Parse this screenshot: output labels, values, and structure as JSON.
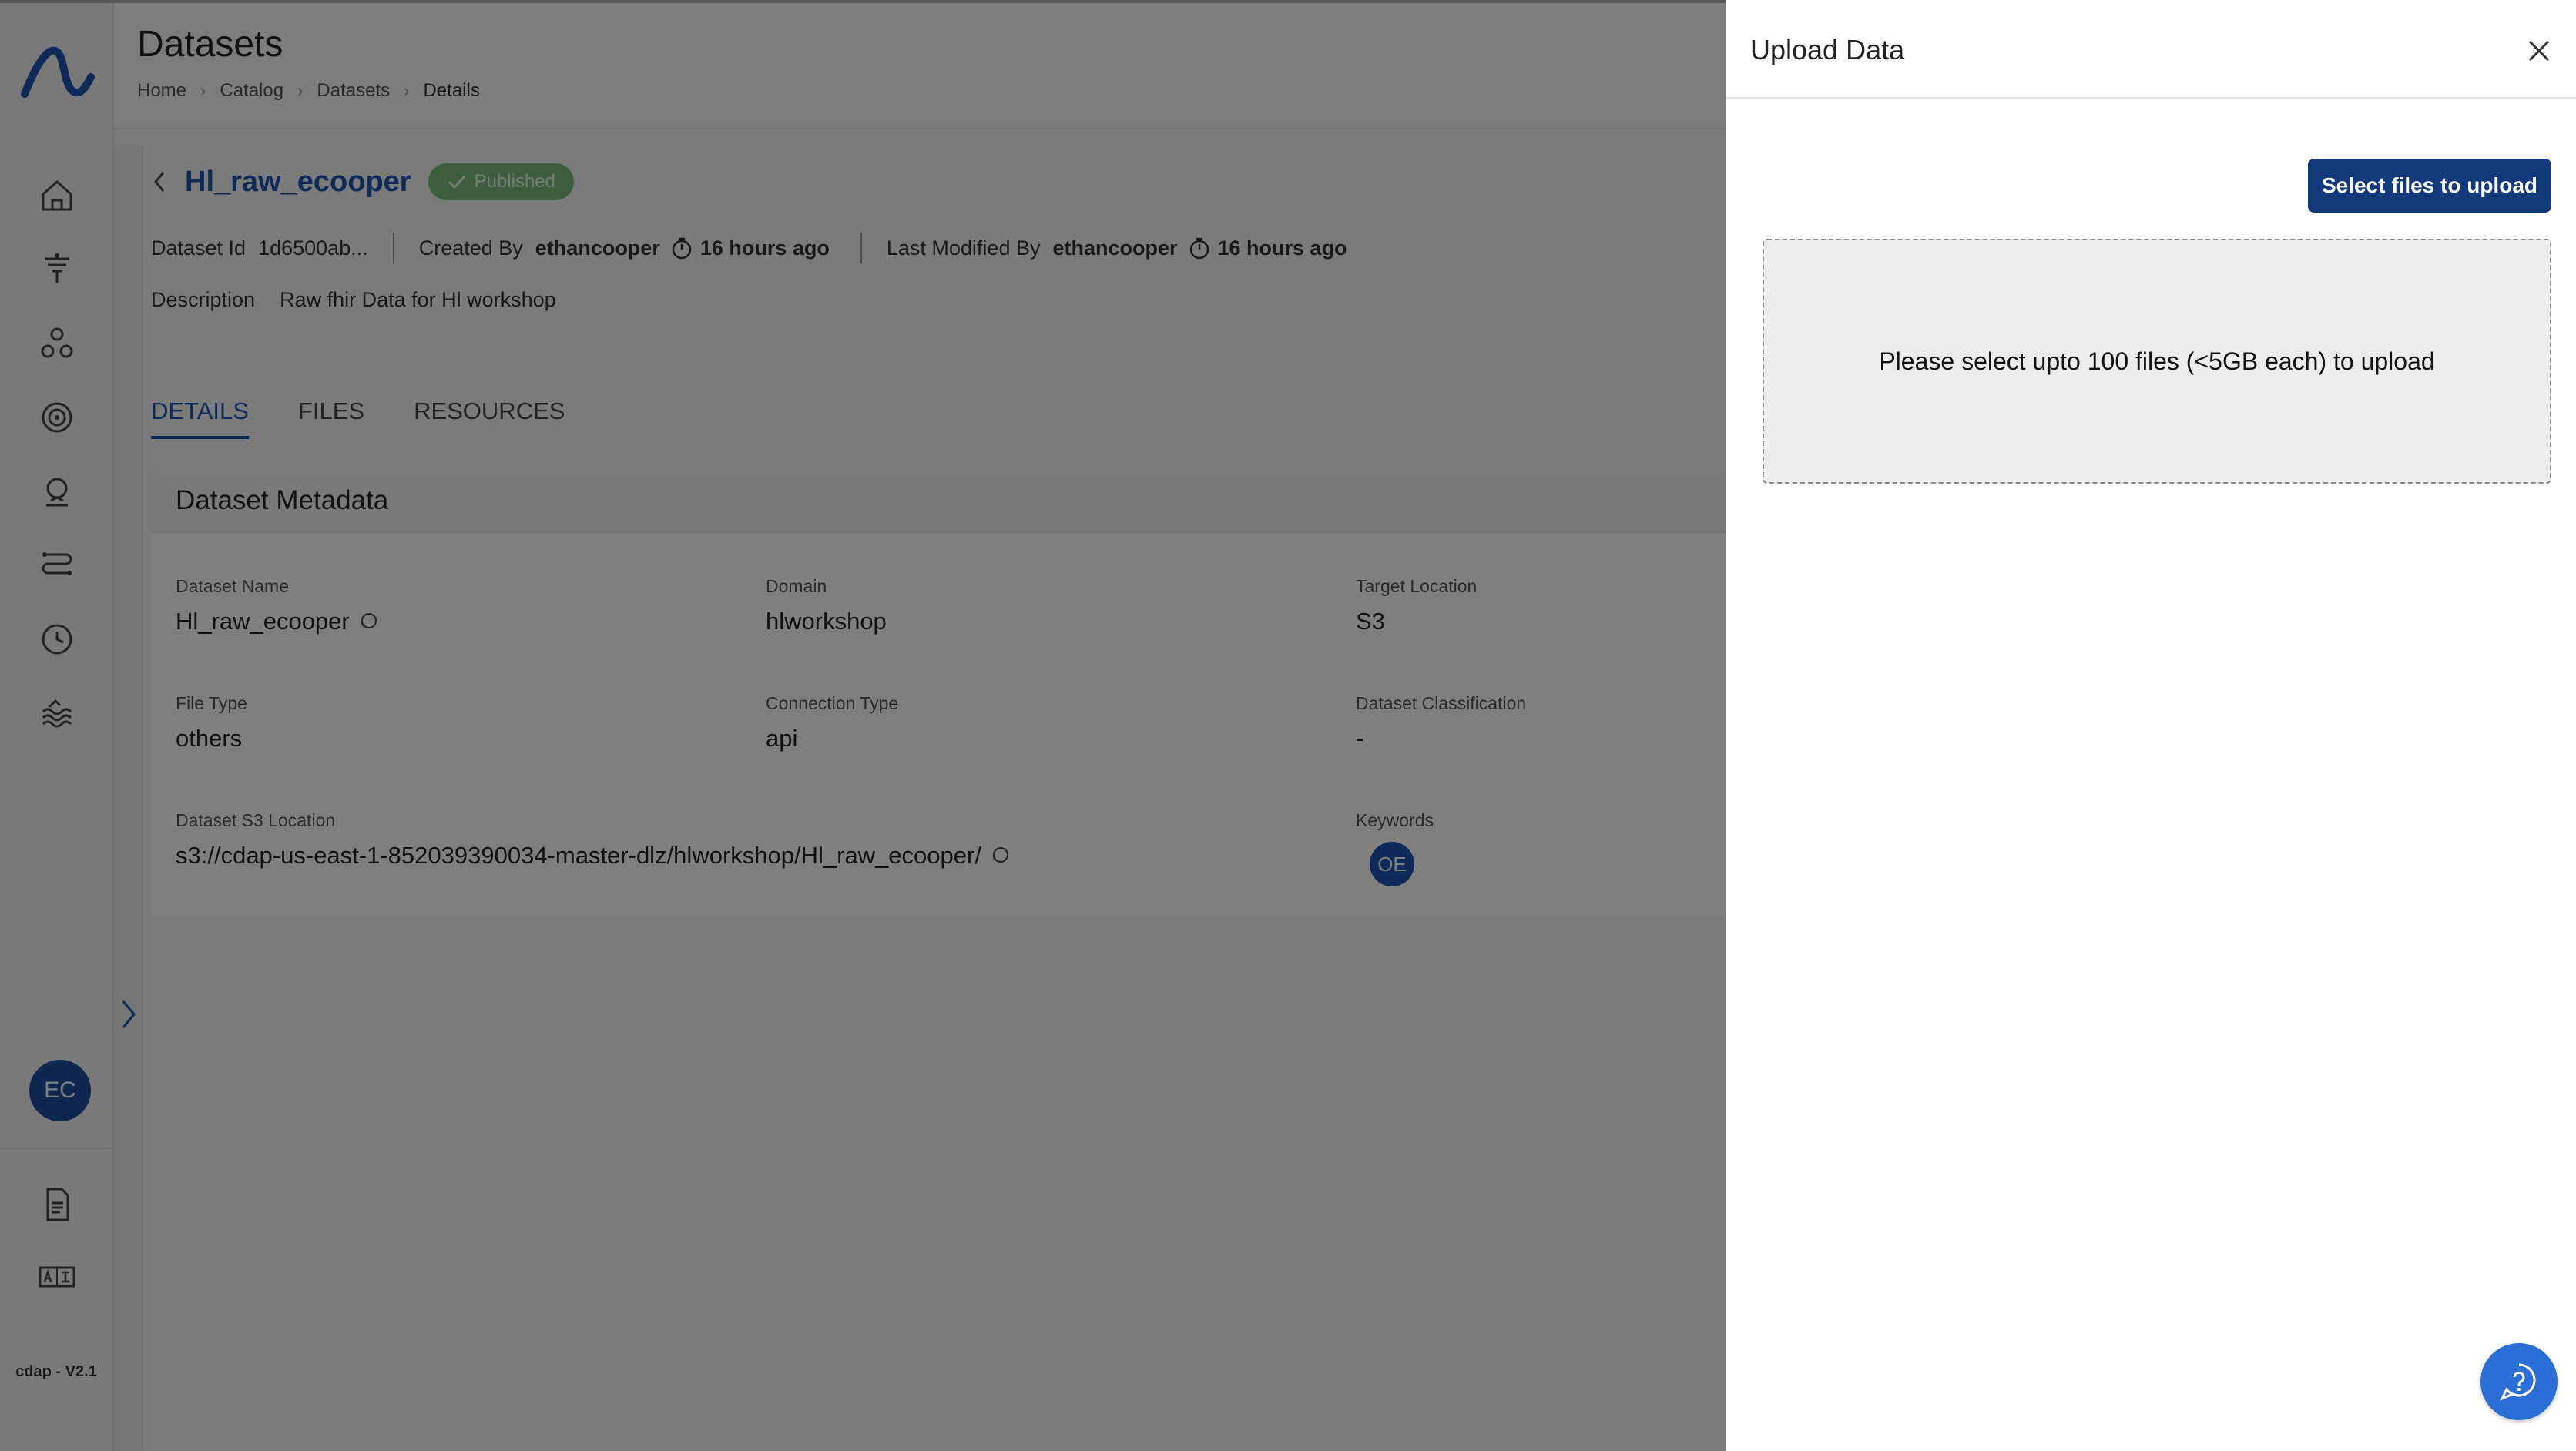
{
  "rail": {
    "version": "cdap - V2.1",
    "avatar_initials": "EC",
    "icons": [
      "home-icon",
      "funnel-icon",
      "network-icon",
      "target-icon",
      "user-badge-icon",
      "workflow-icon",
      "clock-icon",
      "waves-icon",
      "document-icon",
      "translate-icon"
    ]
  },
  "header": {
    "title": "Datasets",
    "breadcrumb": [
      "Home",
      "Catalog",
      "Datasets",
      "Details"
    ]
  },
  "dataset": {
    "name": "Hl_raw_ecooper",
    "status": "Published",
    "id_label": "Dataset Id",
    "id_value": "1d6500ab...",
    "created_by_label": "Created By",
    "created_by": "ethancooper",
    "created_ago": "16 hours ago",
    "modified_by_label": "Last Modified By",
    "modified_by": "ethancooper",
    "modified_ago": "16 hours ago",
    "description_label": "Description",
    "description": "Raw fhir Data for Hl workshop"
  },
  "tabs": [
    "DETAILS",
    "FILES",
    "RESOURCES"
  ],
  "metadata": {
    "title": "Dataset Metadata",
    "dataset_name_label": "Dataset Name",
    "dataset_name": "Hl_raw_ecooper",
    "domain_label": "Domain",
    "domain": "hlworkshop",
    "target_location_label": "Target Location",
    "target_location": "S3",
    "file_type_label": "File Type",
    "file_type": "others",
    "connection_type_label": "Connection Type",
    "connection_type": "api",
    "classification_label": "Dataset Classification",
    "classification": "-",
    "s3_location_label": "Dataset S3 Location",
    "s3_location": "s3://cdap-us-east-1-852039390034-master-dlz/hlworkshop/Hl_raw_ecooper/",
    "keywords_label": "Keywords",
    "keyword_chip": "OE"
  },
  "drawer": {
    "title": "Upload Data",
    "select_button": "Select files to upload",
    "dropzone_text": "Please select upto 100 files (<5GB each) to upload"
  },
  "colors": {
    "primary": "#1e54b0",
    "button_dark": "#123a7a",
    "published": "#7dbb7d",
    "fab": "#2b6fd6"
  }
}
